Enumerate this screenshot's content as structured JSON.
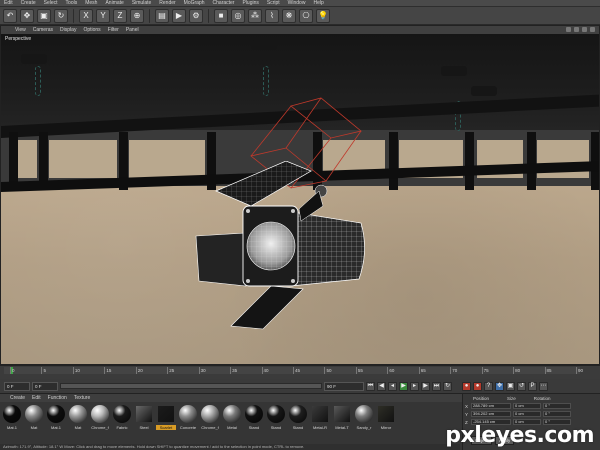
{
  "menubar": {
    "items": [
      "Edit",
      "Create",
      "Select",
      "Tools",
      "Mesh",
      "Animate",
      "Simulate",
      "Render",
      "MoGraph",
      "Character",
      "Plugins",
      "Script",
      "Window",
      "Help"
    ]
  },
  "toolbar": {
    "icons": [
      "undo-icon",
      "move-icon",
      "scale-icon",
      "rotate-icon",
      "x-axis-icon",
      "y-axis-icon",
      "z-axis-icon",
      "world-icon",
      "render-view-icon",
      "render-icon",
      "render-settings-icon",
      "cube-icon",
      "nurbs-icon",
      "array-icon",
      "deformer-icon",
      "scene-icon",
      "camera-icon",
      "light-icon"
    ]
  },
  "viewport": {
    "menu": [
      "View",
      "Cameras",
      "Display",
      "Options",
      "Filter",
      "Panel"
    ],
    "label": "Perspective"
  },
  "timeline": {
    "ticks": [
      "0",
      "5",
      "10",
      "15",
      "20",
      "25",
      "30",
      "35",
      "40",
      "45",
      "50",
      "55",
      "60",
      "65",
      "70",
      "75",
      "80",
      "85",
      "90"
    ],
    "current_frame": "0 F",
    "start_field": "0 F",
    "end_field": "90 F",
    "frame_end_label": "0 F"
  },
  "materials": {
    "menu": [
      "Create",
      "Edit",
      "Function",
      "Texture"
    ],
    "items": [
      {
        "label": "Mat.1",
        "color": "#0a0a0a",
        "shape": "ball"
      },
      {
        "label": "Mat",
        "color": "#8a8a8a",
        "shape": "ball"
      },
      {
        "label": "Mat.1",
        "color": "#0d0d0d",
        "shape": "ball"
      },
      {
        "label": "Mat",
        "color": "#9b9b9b",
        "shape": "ball"
      },
      {
        "label": "Chrome_f",
        "color": "#b9b9b9",
        "shape": "ball"
      },
      {
        "label": "Fabric",
        "color": "#1a1a1a",
        "shape": "ball"
      },
      {
        "label": "Steel",
        "color": "#6a6a6a",
        "shape": "cube"
      },
      {
        "label": "Scarlet",
        "color": "#1b1b1b",
        "shape": "cube"
      },
      {
        "label": "Concrete",
        "color": "#8e8e8e",
        "shape": "ball"
      },
      {
        "label": "Chrome_f",
        "color": "#a8a8a8",
        "shape": "ball"
      },
      {
        "label": "Metal",
        "color": "#7a7a7a",
        "shape": "ball"
      },
      {
        "label": "Stand",
        "color": "#111111",
        "shape": "ball"
      },
      {
        "label": "Stand",
        "color": "#161616",
        "shape": "ball"
      },
      {
        "label": "Stand",
        "color": "#1e1e1e",
        "shape": "ball"
      },
      {
        "label": "Metal-R",
        "color": "#3a3a3a",
        "shape": "cube"
      },
      {
        "label": "Metal-T",
        "color": "#5a5a5a",
        "shape": "cube"
      },
      {
        "label": "Sandy_r",
        "color": "#7c7c7c",
        "shape": "ball"
      },
      {
        "label": "Mirror",
        "color": "#2e2e26",
        "shape": "cube"
      }
    ],
    "selected_index": 7
  },
  "coordinates": {
    "headers": [
      "Position",
      "Size",
      "Rotation"
    ],
    "rows": [
      {
        "axis": "X",
        "position": "288.789 cm",
        "size": "0 cm",
        "rotation": "0 °"
      },
      {
        "axis": "Y",
        "position": "394.202 cm",
        "size": "0 cm",
        "rotation": "0 °"
      },
      {
        "axis": "Z",
        "position": "-254.145 cm",
        "size": "0 cm",
        "rotation": "0 °"
      }
    ],
    "mode_button": "Object",
    "apply_button": "Apply"
  },
  "status": {
    "text": "Azimuth: 171.9°, Altitude: 18.1° W    Move: Click and drag to move elements. Hold down SHIFT to quantize movement / add to the selection in point mode, CTRL to remove."
  },
  "watermark": "pxleyes.com",
  "colors": {
    "background": "#3a3a3a",
    "wall": "#b3a088",
    "selection": "#c0392b",
    "wireframe": "#ffffff",
    "playhead": "#3ea446",
    "selected_material": "#d89b25"
  }
}
